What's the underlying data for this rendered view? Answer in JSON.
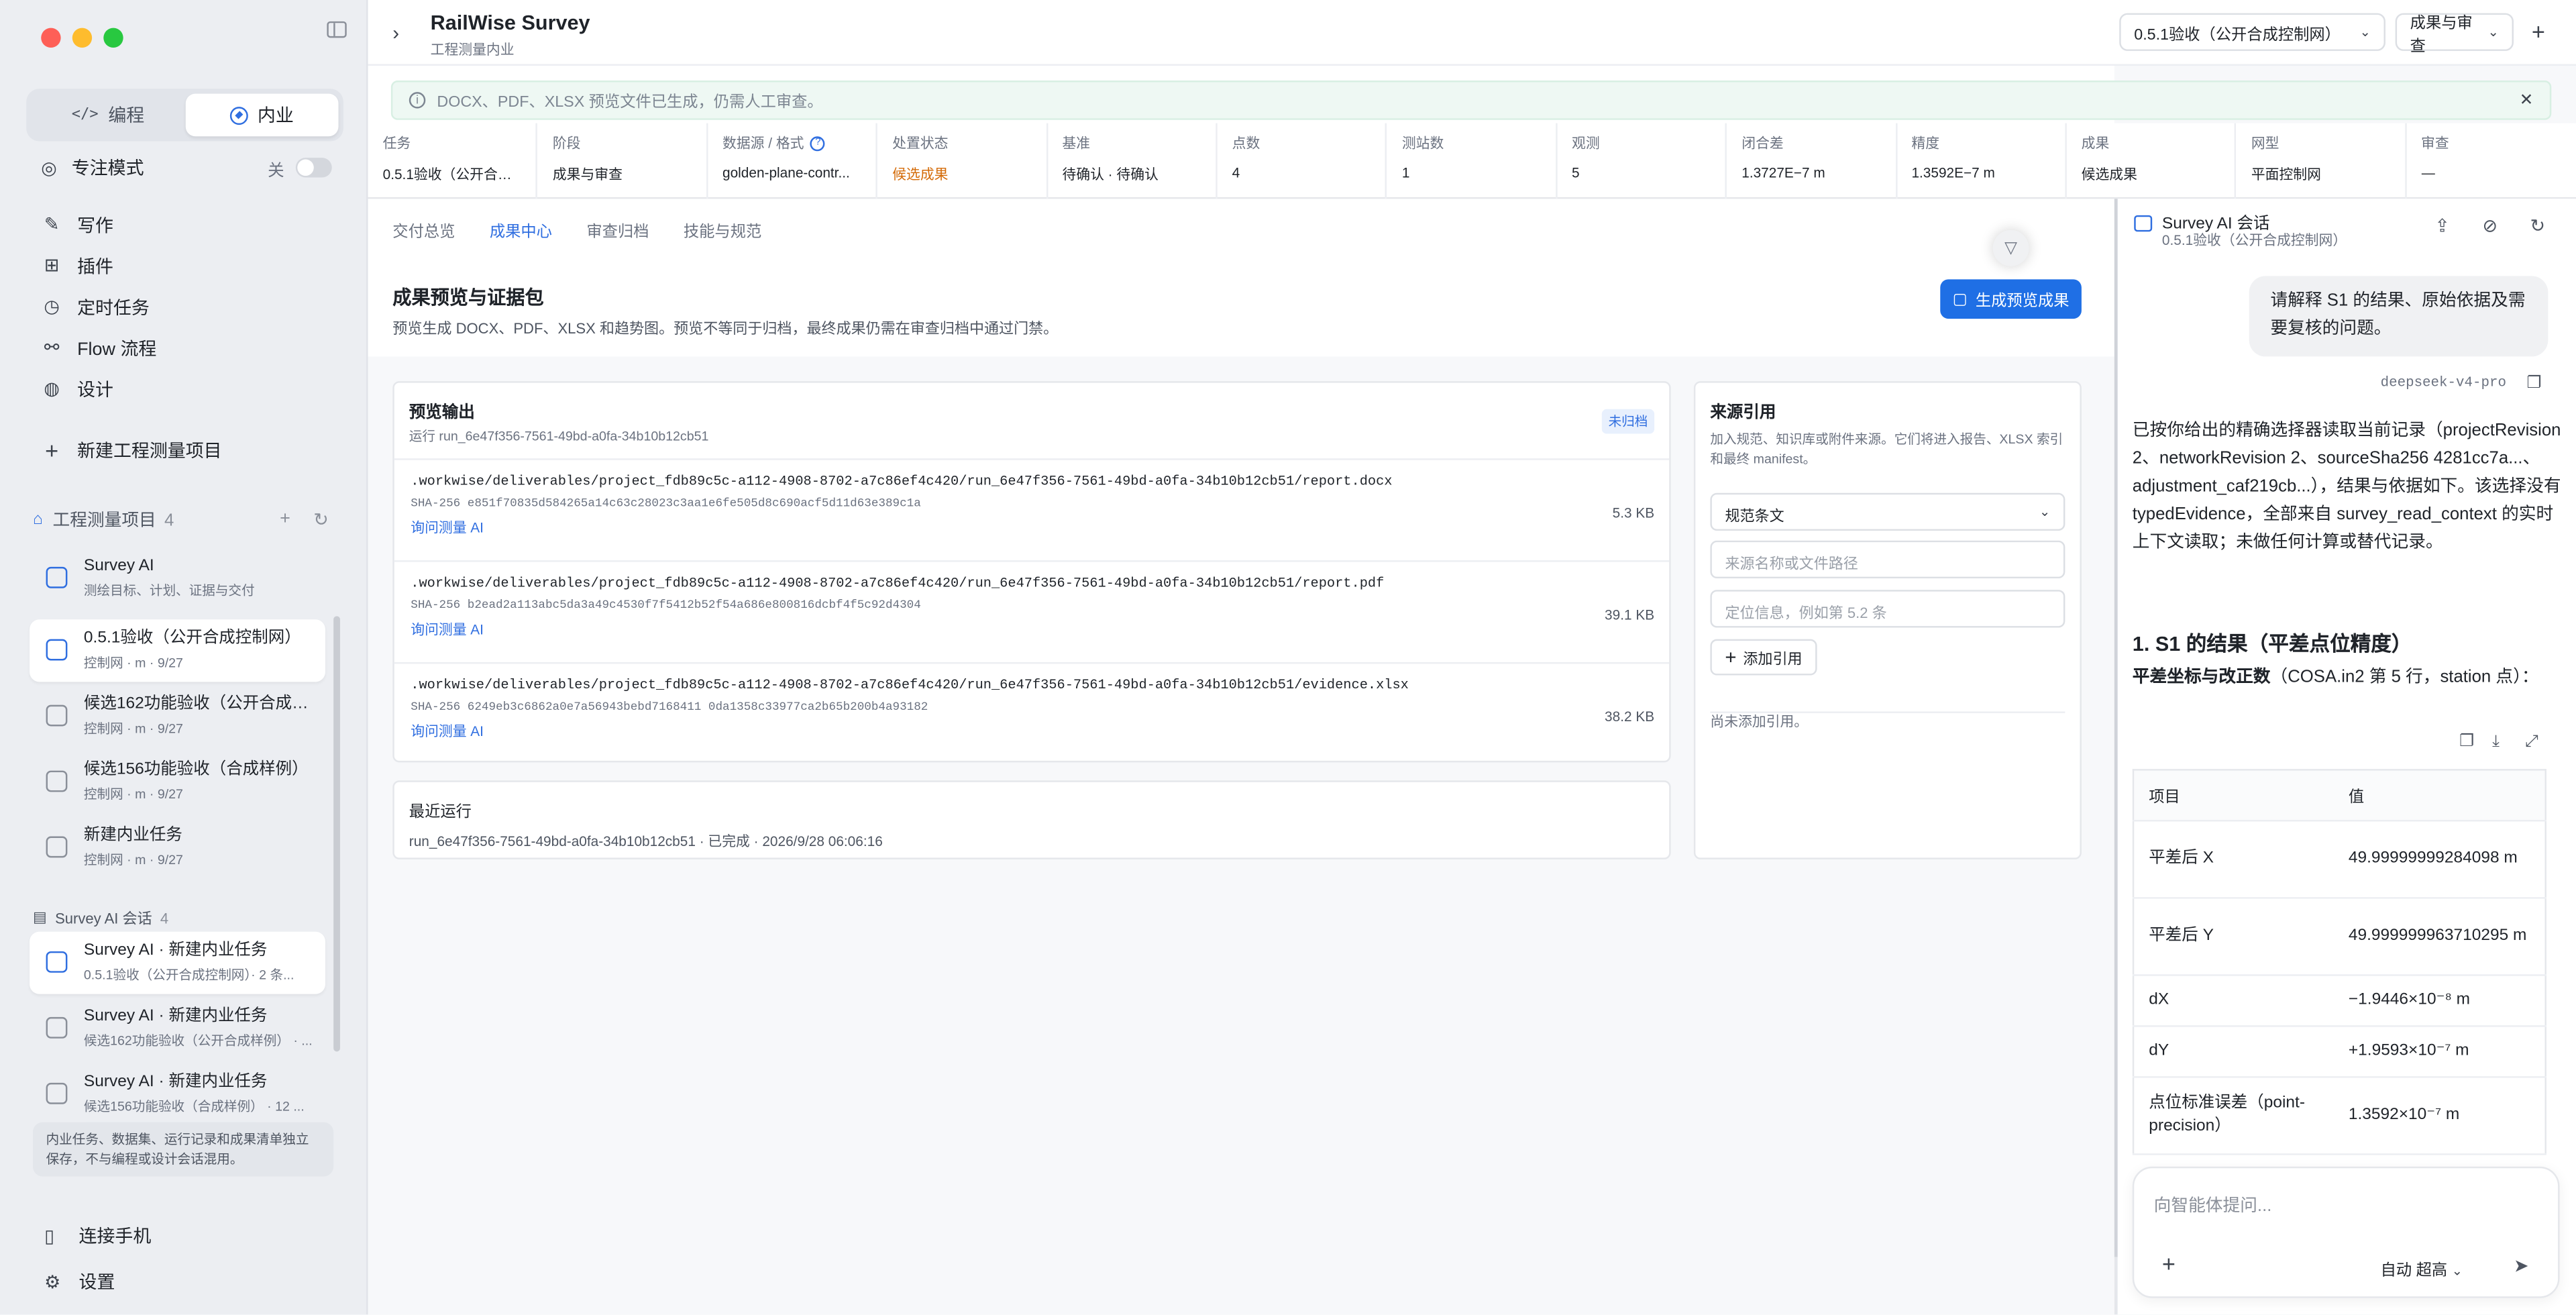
{
  "sidebar": {
    "modes": [
      "编程",
      "内业"
    ],
    "focus_label": "专注模式",
    "focus_state": "关",
    "nav": [
      "写作",
      "插件",
      "定时任务",
      "Flow 流程",
      "设计"
    ],
    "new_project": "新建工程测量项目",
    "projects_header": "工程测量项目",
    "projects_count": "4",
    "agent": {
      "title": "Survey AI",
      "sub": "测绘目标、计划、证据与交付"
    },
    "projects": [
      {
        "title": "0.5.1验收（公开合成控制网）",
        "sub": "控制网 · m · 9/27"
      },
      {
        "title": "候选162功能验收（公开合成样例）",
        "sub": "控制网 · m · 9/27"
      },
      {
        "title": "候选156功能验收（合成样例）",
        "sub": "控制网 · m · 9/27"
      },
      {
        "title": "新建内业任务",
        "sub": "控制网 · m · 9/27"
      }
    ],
    "sessions_header": "Survey AI 会话",
    "sessions_count": "4",
    "sessions": [
      {
        "title": "Survey AI · 新建内业任务",
        "sub": "0.5.1验收（公开合成控制网）· 2 条..."
      },
      {
        "title": "Survey AI · 新建内业任务",
        "sub": "候选162功能验收（公开合成样例） · ..."
      },
      {
        "title": "Survey AI · 新建内业任务",
        "sub": "候选156功能验收（合成样例） · 12 ..."
      }
    ],
    "note": "内业任务、数据集、运行记录和成果清单独立保存，不与编程或设计会话混用。",
    "footer": [
      "连接手机",
      "设置"
    ]
  },
  "header": {
    "title": "RailWise Survey",
    "subtitle": "工程测量内业",
    "select_task": "0.5.1验收（公开合成控制网）",
    "select_stage": "成果与审查"
  },
  "notice": "DOCX、PDF、XLSX 预览文件已生成，仍需人工审查。",
  "stats": [
    {
      "k": "任务",
      "v": "0.5.1验收（公开合成..."
    },
    {
      "k": "阶段",
      "v": "成果与审查"
    },
    {
      "k": "数据源 / 格式",
      "v": "golden-plane-contr..."
    },
    {
      "k": "处置状态",
      "v": "候选成果"
    },
    {
      "k": "基准",
      "v": "待确认 · 待确认"
    },
    {
      "k": "点数",
      "v": "4"
    },
    {
      "k": "测站数",
      "v": "1"
    },
    {
      "k": "观测",
      "v": "5"
    },
    {
      "k": "闭合差",
      "v": "1.3727E−7 m"
    },
    {
      "k": "精度",
      "v": "1.3592E−7 m"
    },
    {
      "k": "成果",
      "v": "候选成果"
    },
    {
      "k": "网型",
      "v": "平面控制网"
    },
    {
      "k": "审查",
      "v": "—"
    }
  ],
  "tabs": [
    "交付总览",
    "成果中心",
    "审查归档",
    "技能与规范"
  ],
  "section": {
    "title": "成果预览与证据包",
    "desc": "预览生成 DOCX、PDF、XLSX 和趋势图。预览不等同于归档，最终成果仍需在审查归档中通过门禁。",
    "gen_button": "生成预览成果"
  },
  "preview": {
    "title": "预览输出",
    "run": "运行 run_6e47f356-7561-49bd-a0fa-34b10b12cb51",
    "tag": "未归档",
    "files": [
      {
        "path": ".workwise/deliverables/project_fdb89c5c-a112-4908-8702-a7c86ef4c420/run_6e47f356-7561-49bd-a0fa-34b10b12cb51/report.docx",
        "sha": "SHA-256 e851f70835d584265a14c63c28023c3aa1e6fe505d8c690acf5d11d63e389c1a",
        "link": "询问测量 AI",
        "size": "5.3 KB"
      },
      {
        "path": ".workwise/deliverables/project_fdb89c5c-a112-4908-8702-a7c86ef4c420/run_6e47f356-7561-49bd-a0fa-34b10b12cb51/report.pdf",
        "sha": "SHA-256 b2ead2a113abc5da3a49c4530f7f5412b52f54a686e800816dcbf4f5c92d4304",
        "link": "询问测量 AI",
        "size": "39.1 KB"
      },
      {
        "path": ".workwise/deliverables/project_fdb89c5c-a112-4908-8702-a7c86ef4c420/run_6e47f356-7561-49bd-a0fa-34b10b12cb51/evidence.xlsx",
        "sha": "SHA-256 6249eb3c6862a0e7a56943bebd7168411 0da1358c33977ca2b65b200b4a93182",
        "link": "询问测量 AI",
        "size": "38.2 KB"
      }
    ]
  },
  "recent": {
    "title": "最近运行",
    "text": "run_6e47f356-7561-49bd-a0fa-34b10b12cb51 · 已完成 · 2026/9/28 06:06:16"
  },
  "sources": {
    "title": "来源引用",
    "desc": "加入规范、知识库或附件来源。它们将进入报告、XLSX 索引和最终 manifest。",
    "select": "规范条文",
    "name_ph": "来源名称或文件路径",
    "loc_ph": "定位信息，例如第 5.2 条",
    "add": "添加引用",
    "empty": "尚未添加引用。"
  },
  "chat": {
    "title": "Survey AI 会话",
    "subtitle": "0.5.1验收（公开合成控制网）",
    "question": "请解释 S1 的结果、原始依据及需要复核的问题。",
    "model": "deepseek-v4-pro",
    "answer": "已按你给出的精确选择器读取当前记录（projectRevision 2、networkRevision 2、sourceSha256 4281cc7a...、adjustment_caf219cb...），结果与依据如下。该选择没有 typedEvidence，全部来自 survey_read_context 的实时上下文读取；未做任何计算或替代记录。",
    "h1": "1. S1 的结果（平差点位精度）",
    "p2_bold": "平差坐标与改正数",
    "p2_rest": "（COSA.in2 第 5 行，station 点）：",
    "table_head": [
      "项目",
      "值"
    ],
    "table_rows": [
      [
        "平差后 X",
        "49.99999999284098 m"
      ],
      [
        "平差后 Y",
        "49.999999963710295 m"
      ],
      [
        "dX",
        "−1.9446×10⁻⁸ m"
      ],
      [
        "dY",
        "+1.9593×10⁻⁷ m"
      ],
      [
        "点位标准误差（point-precision）",
        "1.3592×10⁻⁷ m"
      ]
    ],
    "input_ph": "向智能体提问...",
    "mode": "自动  超高"
  }
}
